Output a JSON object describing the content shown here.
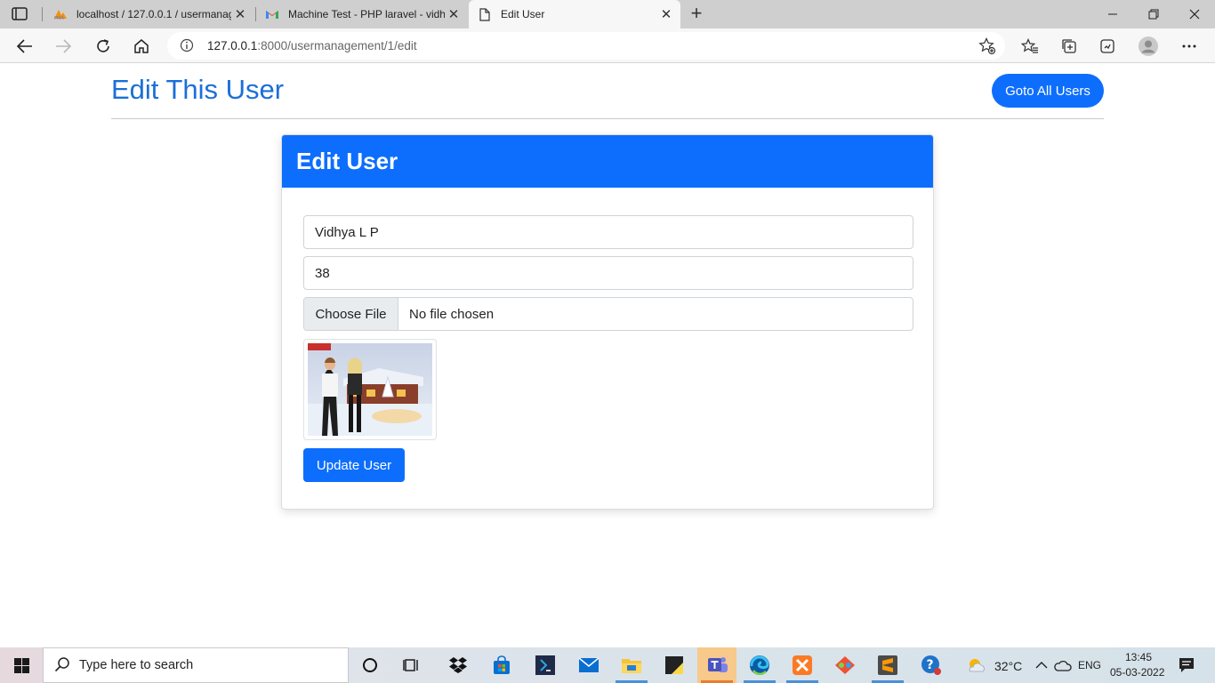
{
  "browser": {
    "tabs": [
      {
        "title": "localhost / 127.0.0.1 / usermanag"
      },
      {
        "title": "Machine Test - PHP laravel - vidh"
      },
      {
        "title": "Edit User"
      }
    ],
    "close_glyph": "✕",
    "new_tab_glyph": "+",
    "url_host": "127.0.0.1",
    "url_rest": ":8000/usermanagement/1/edit"
  },
  "page": {
    "title": "Edit This User",
    "goto_button": "Goto All Users"
  },
  "form": {
    "heading": "Edit User",
    "name_value": "Vidhya L P",
    "age_value": "38",
    "file_button": "Choose File",
    "file_status": "No file chosen",
    "submit": "Update User"
  },
  "taskbar": {
    "search_placeholder": "Type here to search",
    "weather": "32°C",
    "language": "ENG",
    "time": "13:45",
    "date": "05-03-2022"
  },
  "colors": {
    "primary": "#0d6efd",
    "title_blue": "#1b6fd8"
  }
}
